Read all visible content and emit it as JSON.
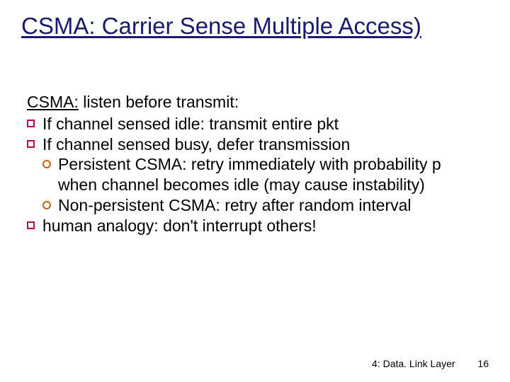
{
  "title": "CSMA: Carrier Sense Multiple Access)",
  "lead_label": "CSMA:",
  "lead_rest": " listen before transmit:",
  "b1": "If channel sensed idle: transmit entire pkt",
  "b2": "If channel sensed busy, defer transmission",
  "b2_1": "Persistent CSMA: retry immediately with probability p when channel becomes idle (may cause instability)",
  "b2_2": "Non-persistent CSMA: retry after random interval",
  "b3": "human analogy: don't interrupt others!",
  "footer_chapter": "4: Data. Link Layer",
  "footer_page": "16"
}
